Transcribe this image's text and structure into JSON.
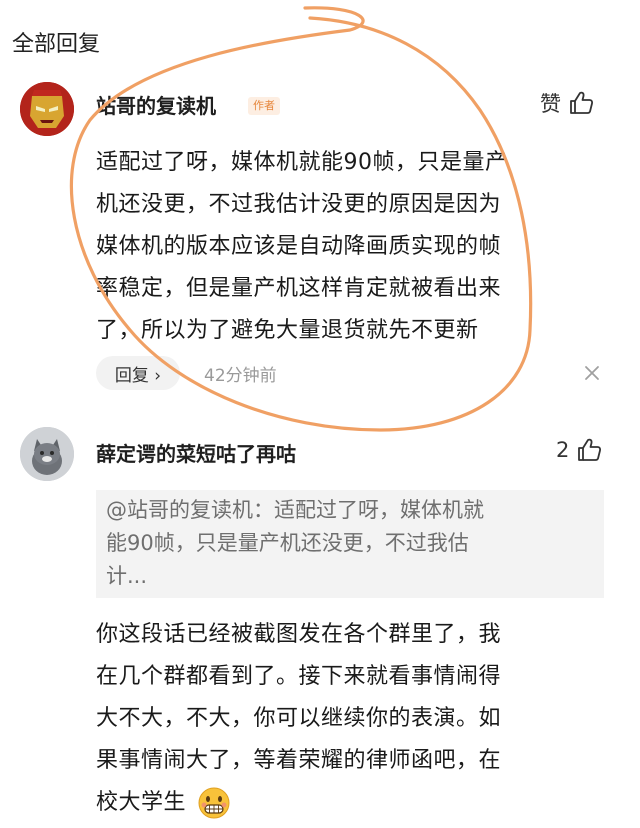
{
  "header": {
    "title": "全部回复"
  },
  "comments": [
    {
      "username": "站哥的复读机",
      "badge": "作者",
      "like_label": "赞",
      "avatar_icon": "ironman-avatar",
      "lines": [
        "适配过了呀，媒体机就能90帧，只是量产",
        "机还没更，不过我估计没更的原因是因为",
        "媒体机的版本应该是自动降画质实现的帧",
        "率稳定，但是量产机这样肯定就被看出来",
        "了，所以为了避免大量退货就先不更新"
      ],
      "reply_label": "回复 ›",
      "timestamp": "42分钟前"
    },
    {
      "username": "薛定谔的菜短咕了再咕",
      "like_count": "2",
      "avatar_icon": "cat-avatar",
      "quote_lines": [
        "@站哥的复读机：适配过了呀，媒体机就",
        "能90帧，只是量产机还没更，不过我估",
        "计..."
      ],
      "lines": [
        "你这段话已经被截图发在各个群里了，我",
        "在几个群都看到了。接下来就看事情闹得",
        "大不大，不大，你可以继续你的表演。如",
        "果事情闹大了，等着荣耀的律师函吧，在",
        "校大学生"
      ]
    }
  ],
  "colors": {
    "annotation_circle": "#f0a064",
    "author_badge": "#e6863b"
  }
}
